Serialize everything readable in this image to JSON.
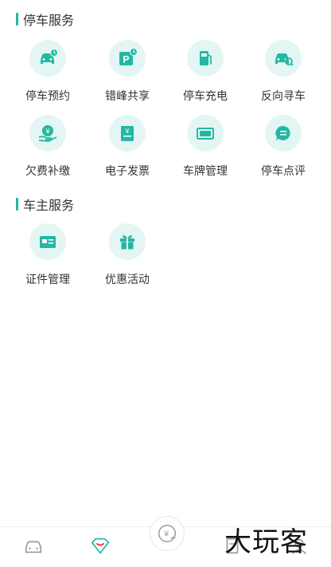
{
  "colors": {
    "accent": "#22b8a4",
    "icon_bg": "#e3f6f3",
    "text": "#333333"
  },
  "parking_services": {
    "title": "停车服务",
    "items": [
      {
        "label": "停车预约",
        "icon": "car-clock-icon"
      },
      {
        "label": "错峰共享",
        "icon": "parking-p-icon"
      },
      {
        "label": "停车充电",
        "icon": "fuel-pump-icon"
      },
      {
        "label": "反向寻车",
        "icon": "car-search-icon"
      },
      {
        "label": "欠费补缴",
        "icon": "yen-hand-icon"
      },
      {
        "label": "电子发票",
        "icon": "invoice-icon"
      },
      {
        "label": "车牌管理",
        "icon": "license-plate-icon"
      },
      {
        "label": "停车点评",
        "icon": "comment-icon"
      }
    ]
  },
  "owner_services": {
    "title": "车主服务",
    "items": [
      {
        "label": "证件管理",
        "icon": "id-card-icon"
      },
      {
        "label": "优惠活动",
        "icon": "gift-icon"
      }
    ]
  },
  "bottom_nav": {
    "center_icon": "yen-exchange-icon"
  },
  "watermark": "大玩客"
}
